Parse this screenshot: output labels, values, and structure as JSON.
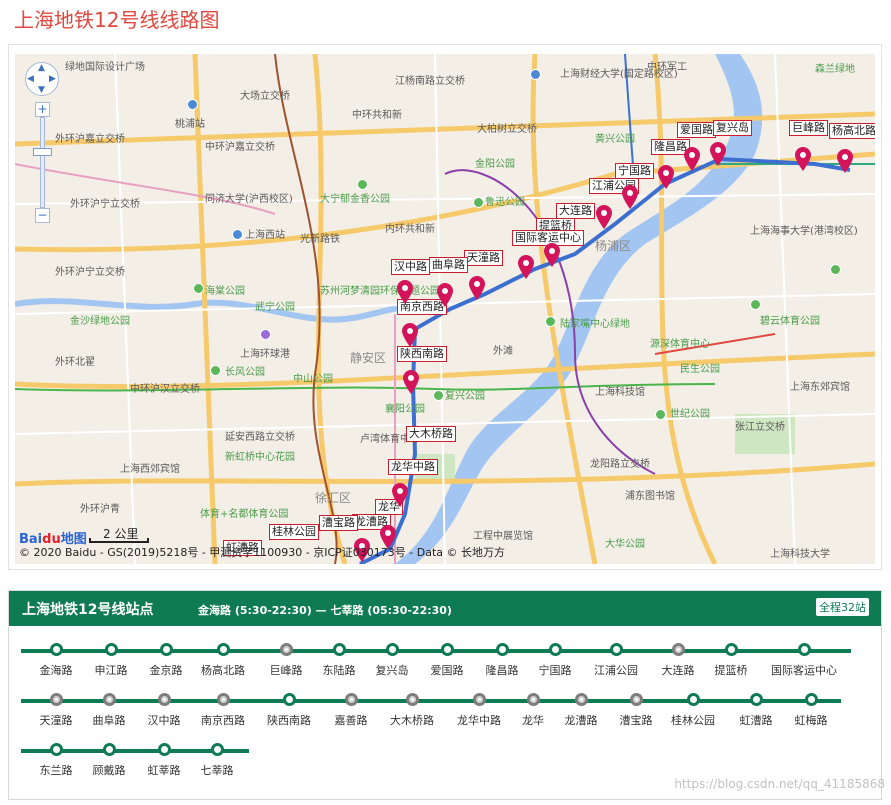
{
  "page": {
    "title": "上海地铁12号线线路图",
    "watermark": "https://blog.csdn.net/qq_41185868"
  },
  "map": {
    "zoom_in": "+",
    "zoom_out": "−",
    "logo_text": "Bai",
    "logo_paw": "du",
    "logo_suffix": "地图",
    "scale": "2 公里",
    "copyright": "© 2020 Baidu - GS(2019)5218号 - 甲测资字1100930 - 京ICP证030173号 - Data © 长地万方",
    "labels": [
      "绿地国际设计广场",
      "大场立交桥",
      "江杨南路立交桥",
      "上海财经大学(国定路校区)",
      "中环军工",
      "中环共和新",
      "大柏树立交桥",
      "森兰绿地",
      "外环沪嘉立交桥",
      "中环沪嘉立交桥",
      "桃浦站",
      "黄兴公园",
      "金阳公园",
      "外环沪宁立交桥",
      "同济大学(沪西校区)",
      "大宁郁金香公园",
      "鲁迅公园",
      "内环共和新",
      "光新路铁",
      "上海西站",
      "外环沪宁立交桥",
      "海棠公园",
      "苏州河梦清园环保主题公园",
      "武宁公园",
      "金沙绿地公园",
      "上海环球港",
      "静安区",
      "陆家嘴中心绿地",
      "外滩",
      "杨浦区",
      "源深体育中心",
      "民生公园",
      "外环北翟",
      "中山公园",
      "长风公园",
      "中环沪汉立交桥",
      "襄阳公园",
      "复兴公园",
      "上海科技馆",
      "世纪公园",
      "延安西路立交桥",
      "新虹桥中心花园",
      "卢湾体育中心",
      "张江立交桥",
      "龙阳路立交桥",
      "上海西郊宾馆",
      "徐汇区",
      "浦东图书馆",
      "外环沪青",
      "体育+名都体育公园",
      "工程中展览馆",
      "大华公园",
      "上海东郊宾馆",
      "上海海事大学(港湾校区)",
      "碧云体育公园",
      "上海科技大学"
    ],
    "station_tags": [
      "巨峰路",
      "杨高北路",
      "爱国路",
      "复兴岛",
      "隆昌路",
      "宁国路",
      "江浦公园",
      "大连路",
      "提篮桥",
      "国际客运中心",
      "天潼路",
      "曲阜路",
      "汉中路",
      "南京西路",
      "陕西南路",
      "大木桥路",
      "龙华中路",
      "龙华",
      "龙漕路",
      "漕宝路",
      "桂林公园",
      "虹漕路"
    ]
  },
  "stations_panel": {
    "title": "上海地铁12号线站点",
    "hours": "金海路 (5:30-22:30) — 七莘路 (05:30-22:30)",
    "count": "全程32站",
    "rows": [
      [
        {
          "name": "金海路",
          "transfer": false
        },
        {
          "name": "申江路",
          "transfer": false
        },
        {
          "name": "金京路",
          "transfer": false
        },
        {
          "name": "杨高北路",
          "transfer": false
        },
        {
          "name": "巨峰路",
          "transfer": true
        },
        {
          "name": "东陆路",
          "transfer": false
        },
        {
          "name": "复兴岛",
          "transfer": false
        },
        {
          "name": "爱国路",
          "transfer": false
        },
        {
          "name": "隆昌路",
          "transfer": false
        },
        {
          "name": "宁国路",
          "transfer": false
        },
        {
          "name": "江浦公园",
          "transfer": false
        },
        {
          "name": "大连路",
          "transfer": true
        },
        {
          "name": "提篮桥",
          "transfer": false
        },
        {
          "name": "国际客运中心",
          "transfer": false
        }
      ],
      [
        {
          "name": "天潼路",
          "transfer": true
        },
        {
          "name": "曲阜路",
          "transfer": true
        },
        {
          "name": "汉中路",
          "transfer": true
        },
        {
          "name": "南京西路",
          "transfer": true
        },
        {
          "name": "陕西南路",
          "transfer": false
        },
        {
          "name": "嘉善路",
          "transfer": true
        },
        {
          "name": "大木桥路",
          "transfer": true
        },
        {
          "name": "龙华中路",
          "transfer": true
        },
        {
          "name": "龙华",
          "transfer": true
        },
        {
          "name": "龙漕路",
          "transfer": true
        },
        {
          "name": "漕宝路",
          "transfer": true
        },
        {
          "name": "桂林公园",
          "transfer": false
        },
        {
          "name": "虹漕路",
          "transfer": false
        },
        {
          "name": "虹梅路",
          "transfer": false
        }
      ],
      [
        {
          "name": "东兰路",
          "transfer": false
        },
        {
          "name": "顾戴路",
          "transfer": false
        },
        {
          "name": "虹莘路",
          "transfer": false
        },
        {
          "name": "七莘路",
          "transfer": false
        }
      ]
    ]
  }
}
